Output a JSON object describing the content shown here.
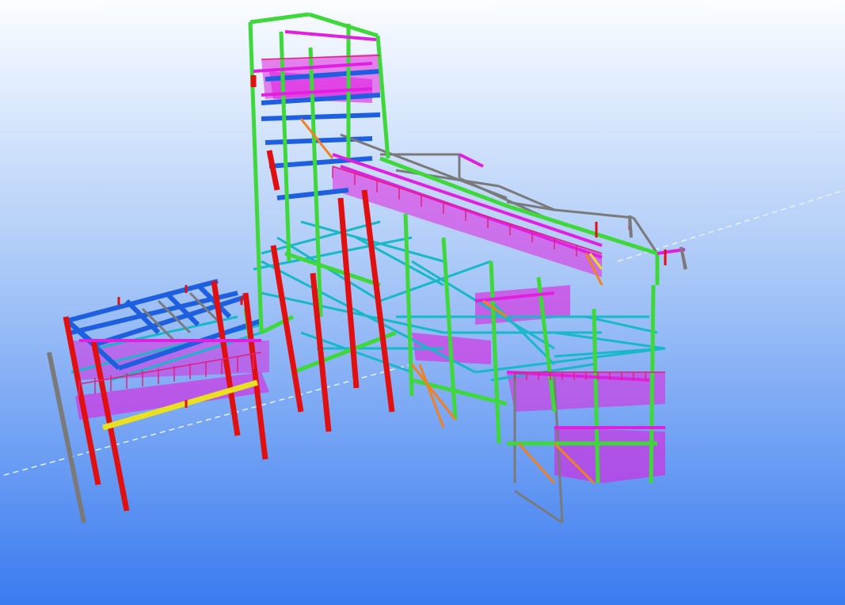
{
  "viewport": {
    "background": {
      "top": "#fbfdff",
      "bottom": "#3a7bf0"
    },
    "view_mode": "3d-perspective"
  },
  "model": {
    "type": "steel-structure",
    "member_colors": {
      "columns_primary": "#e01010",
      "columns_secondary": "#3fd83a",
      "beams_primary": "#1e5fe0",
      "bracing": "#18b8c8",
      "platforms": "#e020e0",
      "secondary_members": "#7a7a7a",
      "pipe": "#e8e020",
      "handrails": "#e02080",
      "stair_stringers": "#f08020"
    }
  }
}
